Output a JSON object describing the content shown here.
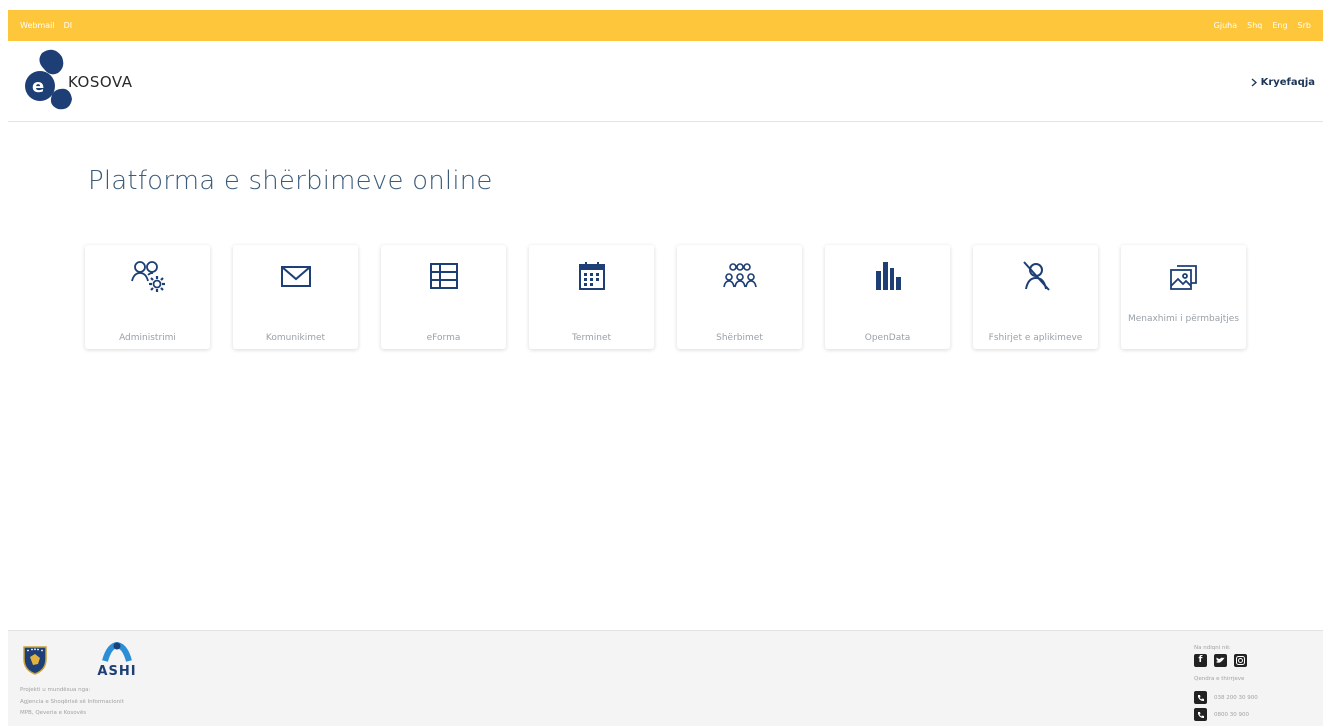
{
  "topbar": {
    "links": [
      "Webmail",
      "DI"
    ],
    "language_label": "Gjuha",
    "languages": [
      "Shq",
      "Eng",
      "Srb"
    ]
  },
  "header": {
    "logo_text": "KOSOVA",
    "home_link": "Kryefaqja"
  },
  "main": {
    "title": "Platforma e shërbimeve online",
    "cards": [
      {
        "label": "Administrimi",
        "icon": "users-gear-icon"
      },
      {
        "label": "Komunikimet",
        "icon": "envelope-icon"
      },
      {
        "label": "eForma",
        "icon": "table-form-icon"
      },
      {
        "label": "Terminet",
        "icon": "calendar-icon"
      },
      {
        "label": "Shërbimet",
        "icon": "group-icon"
      },
      {
        "label": "OpenData",
        "icon": "bar-chart-icon"
      },
      {
        "label": "Fshirjet e aplikimeve",
        "icon": "user-remove-icon"
      },
      {
        "label": "Menaxhimi i përmbajtjes",
        "icon": "image-gallery-icon"
      }
    ]
  },
  "footer": {
    "ashi_label": "ASHI",
    "credits": [
      "Projekti u mundësua nga:",
      "Agjencia e Shoqërisë së Informacionit",
      "MPB, Qeveria e Kosovës"
    ],
    "follow_label": "Na ndiqni në:",
    "social": [
      "facebook-icon",
      "twitter-icon",
      "instagram-icon"
    ],
    "callcenter_label": "Qendra e thirrjeve",
    "phones": [
      "038 200 30 900",
      "0800 30 900"
    ]
  },
  "colors": {
    "topbar": "#fec63a",
    "brand_blue": "#1d3f76",
    "title_blue": "#3b5b7a"
  }
}
